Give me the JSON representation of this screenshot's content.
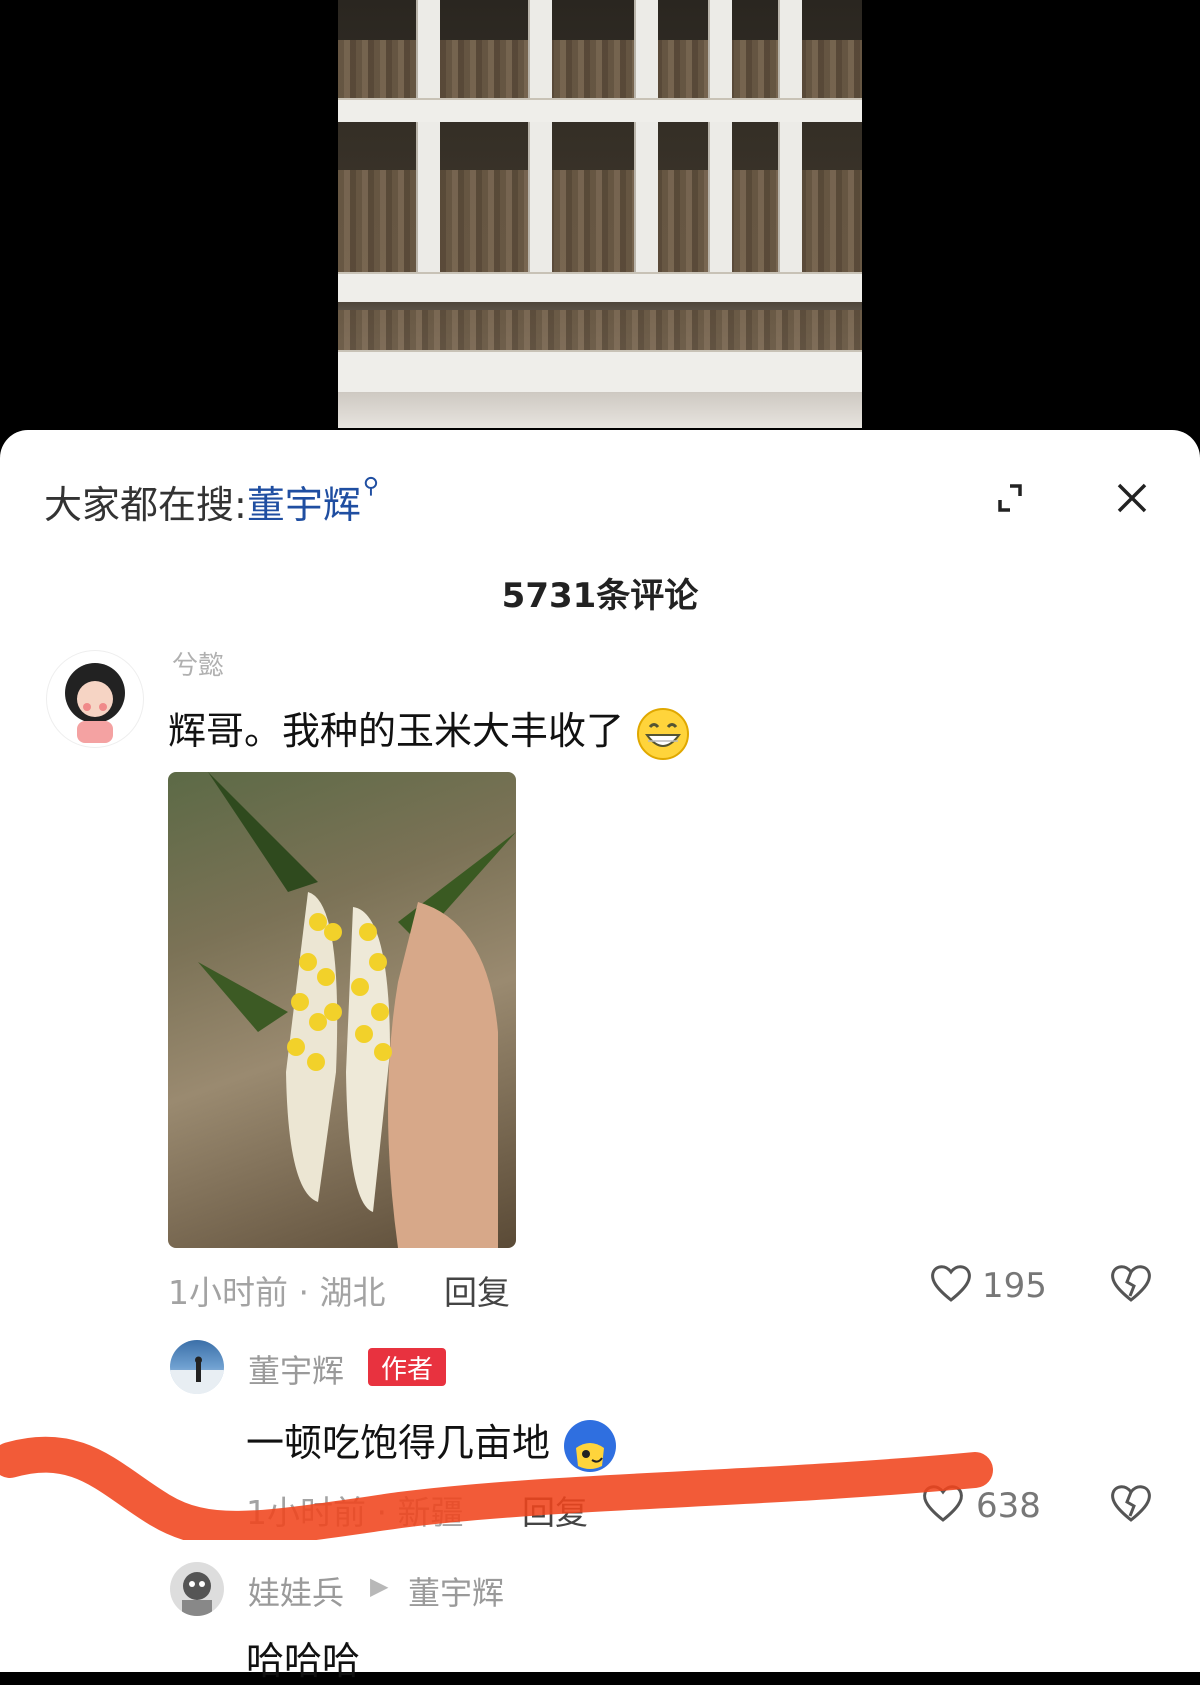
{
  "search_hint": {
    "prefix": "大家都在搜:",
    "keyword": "董宇辉"
  },
  "comments_title": "5731条评论",
  "comment1": {
    "username": "兮懿",
    "text": "辉哥。我种的玉米大丰收了",
    "time_location": "1小时前 · 湖北",
    "reply_label": "回复",
    "like_count": "195"
  },
  "reply1": {
    "username": "董宇辉",
    "badge": "作者",
    "text": "一顿吃饱得几亩地",
    "time_location": "1小时前 · 新疆",
    "reply_label": "回复",
    "like_count": "638"
  },
  "reply2": {
    "username": "娃娃兵",
    "reply_to": "董宇辉",
    "text": "哈哈哈"
  },
  "colors": {
    "keyword": "#1f4ea1",
    "badge": "#e8323f",
    "scribble": "#f0441c"
  }
}
